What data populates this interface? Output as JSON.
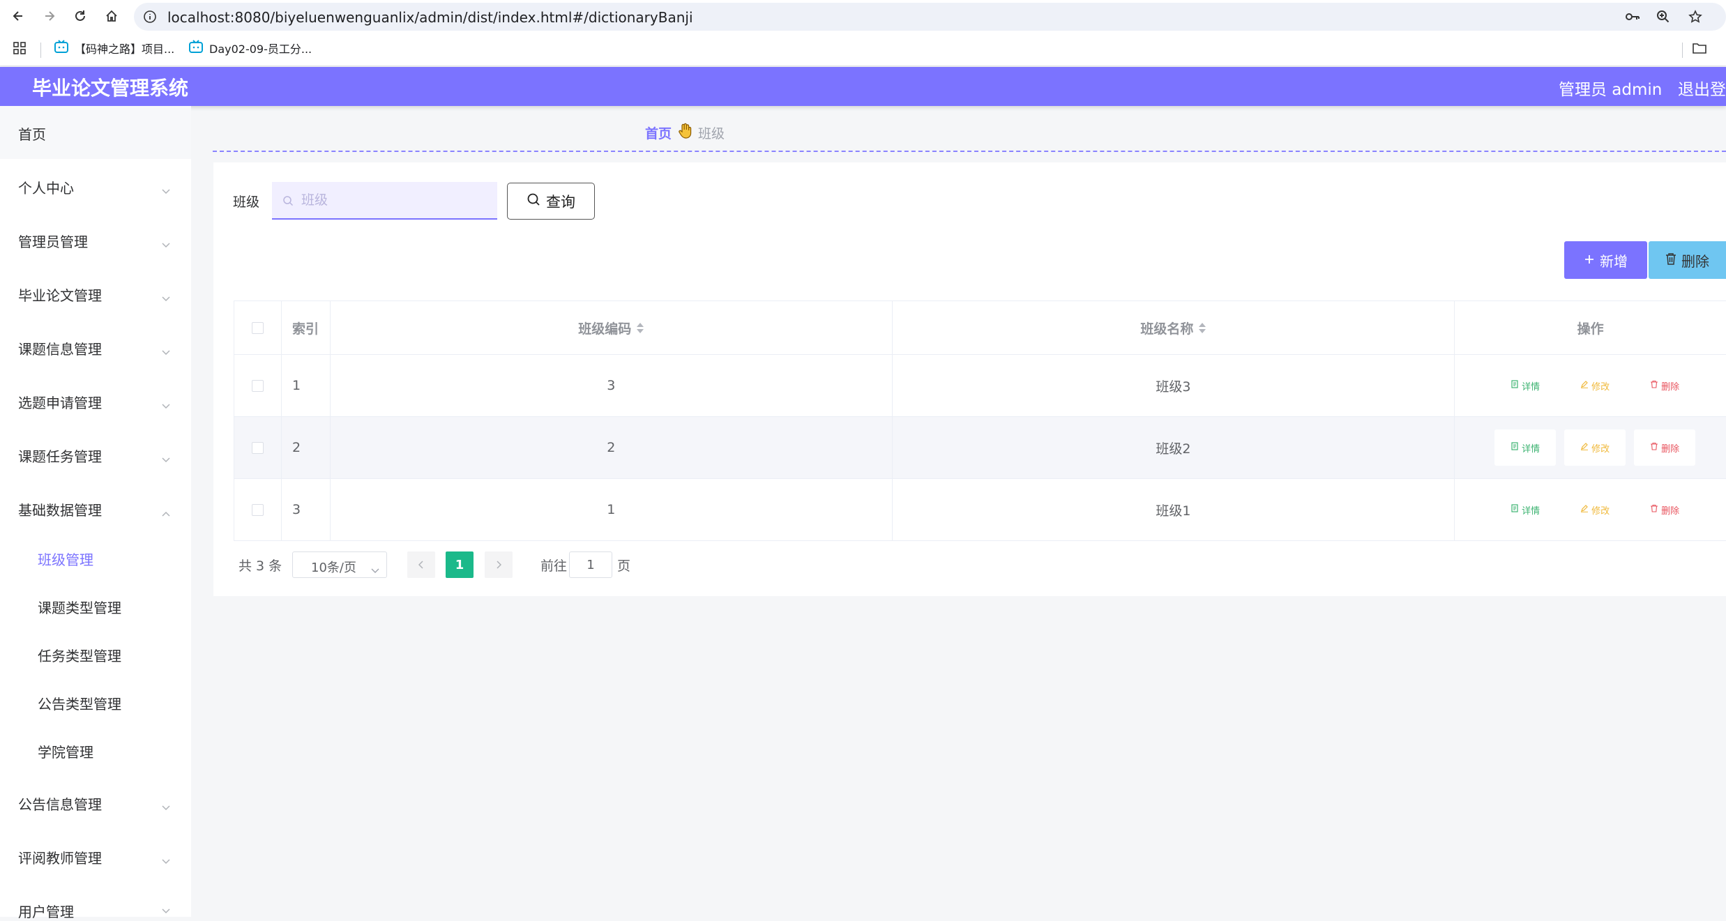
{
  "browser": {
    "url": "localhost:8080/biyeluenwenguanlix/admin/dist/index.html#/dictionaryBanji",
    "bookmarks": [
      {
        "label": "【码神之路】项目..."
      },
      {
        "label": "Day02-09-员工分..."
      }
    ]
  },
  "header": {
    "title": "毕业论文管理系统",
    "user": "管理员 admin",
    "logout": "退出登"
  },
  "sidebar": {
    "home": "首页",
    "items": [
      {
        "label": "个人中心"
      },
      {
        "label": "管理员管理"
      },
      {
        "label": "毕业论文管理"
      },
      {
        "label": "课题信息管理"
      },
      {
        "label": "选题申请管理"
      },
      {
        "label": "课题任务管理"
      },
      {
        "label": "基础数据管理"
      }
    ],
    "subitems": [
      {
        "label": "班级管理"
      },
      {
        "label": "课题类型管理"
      },
      {
        "label": "任务类型管理"
      },
      {
        "label": "公告类型管理"
      },
      {
        "label": "学院管理"
      }
    ],
    "items_after": [
      {
        "label": "公告信息管理"
      },
      {
        "label": "评阅教师管理"
      },
      {
        "label": "用户管理"
      }
    ]
  },
  "breadcrumb": {
    "home": "首页",
    "current": "班级"
  },
  "search": {
    "label": "班级",
    "placeholder": "班级",
    "button": "查询"
  },
  "actions": {
    "add": "新增",
    "delete": "删除"
  },
  "table": {
    "columns": {
      "index": "索引",
      "code": "班级编码",
      "name": "班级名称",
      "ops": "操作"
    },
    "rows": [
      {
        "index": "1",
        "code": "3",
        "name": "班级3"
      },
      {
        "index": "2",
        "code": "2",
        "name": "班级2"
      },
      {
        "index": "3",
        "code": "1",
        "name": "班级1"
      }
    ],
    "op_labels": {
      "detail": "详情",
      "edit": "修改",
      "delete": "删除"
    }
  },
  "pagination": {
    "total": "共 3 条",
    "page_size": "10条/页",
    "current": "1",
    "goto_label": "前往",
    "goto_value": "1",
    "page_label": "页"
  },
  "colors": {
    "accent": "#7b73ff",
    "page_active": "#1bb98a",
    "delete_btn": "#6fc6f1"
  }
}
